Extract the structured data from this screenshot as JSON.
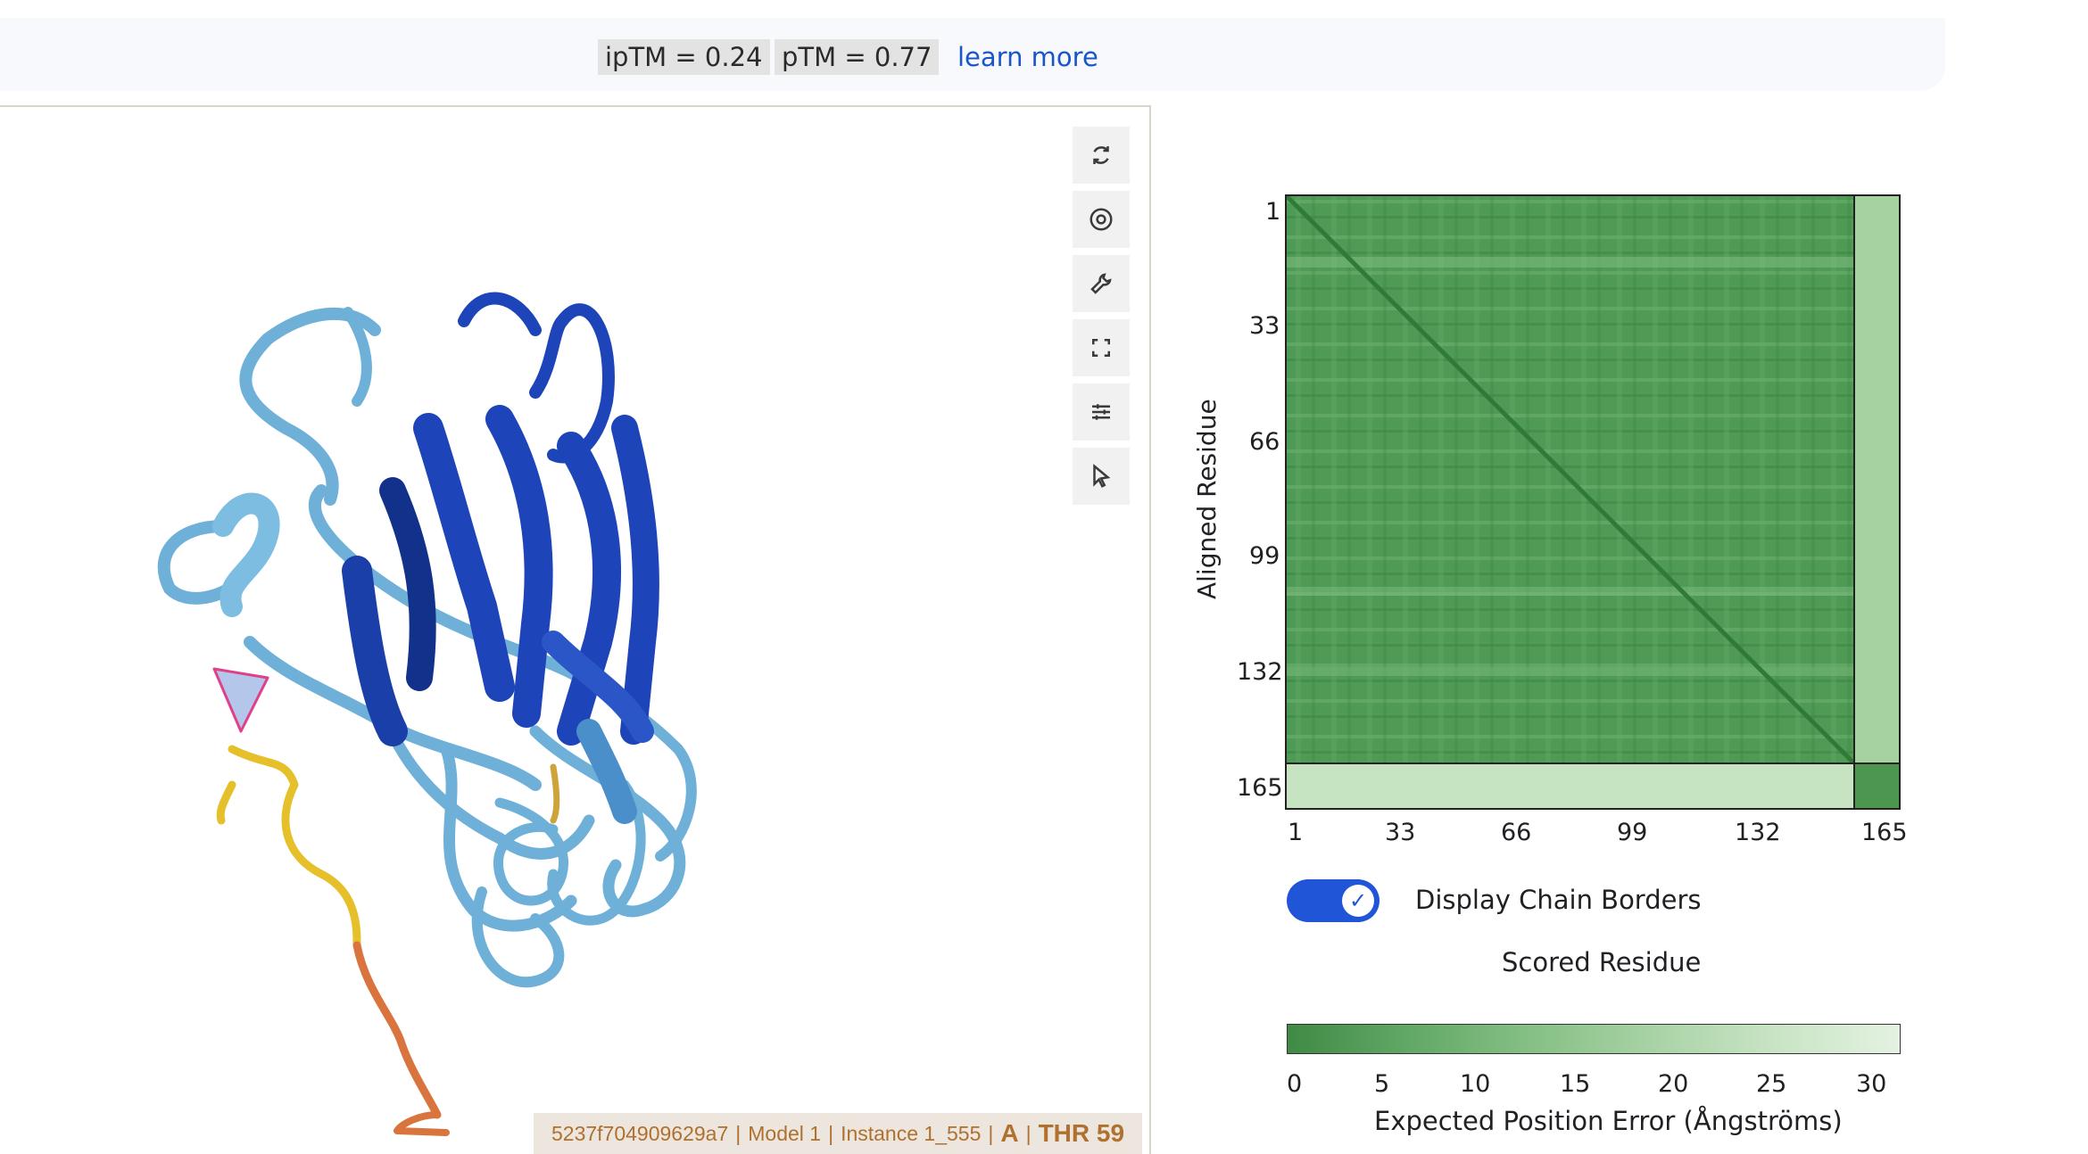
{
  "metrics": {
    "iptm": "ipTM = 0.24",
    "ptm": "pTM = 0.77",
    "learn_more": "learn more"
  },
  "viewer": {
    "tools": [
      {
        "name": "reset-view-icon"
      },
      {
        "name": "screenshot-icon"
      },
      {
        "name": "wrench-icon"
      },
      {
        "name": "fullscreen-icon"
      },
      {
        "name": "settings-sliders-icon"
      },
      {
        "name": "pointer-select-icon"
      }
    ],
    "status": {
      "id": "5237f704909629a7",
      "model": "Model 1",
      "instance": "Instance 1_555",
      "chain": "A",
      "residue": "THR 59"
    }
  },
  "pae": {
    "y_axis_label": "Aligned Residue",
    "y_ticks": [
      "1",
      "33",
      "66",
      "99",
      "132",
      "165"
    ],
    "x_ticks": [
      "1",
      "33",
      "66",
      "99",
      "132",
      "165"
    ],
    "toggle_label": "Display Chain Borders",
    "toggle_on": true,
    "x_axis_label": "Scored Residue",
    "colorbar_ticks": [
      "0",
      "5",
      "10",
      "15",
      "20",
      "25",
      "30"
    ],
    "colorbar_label": "Expected Position Error (Ångströms)",
    "colors": {
      "low": "#3f8a45",
      "high": "#e4f2e1"
    }
  }
}
